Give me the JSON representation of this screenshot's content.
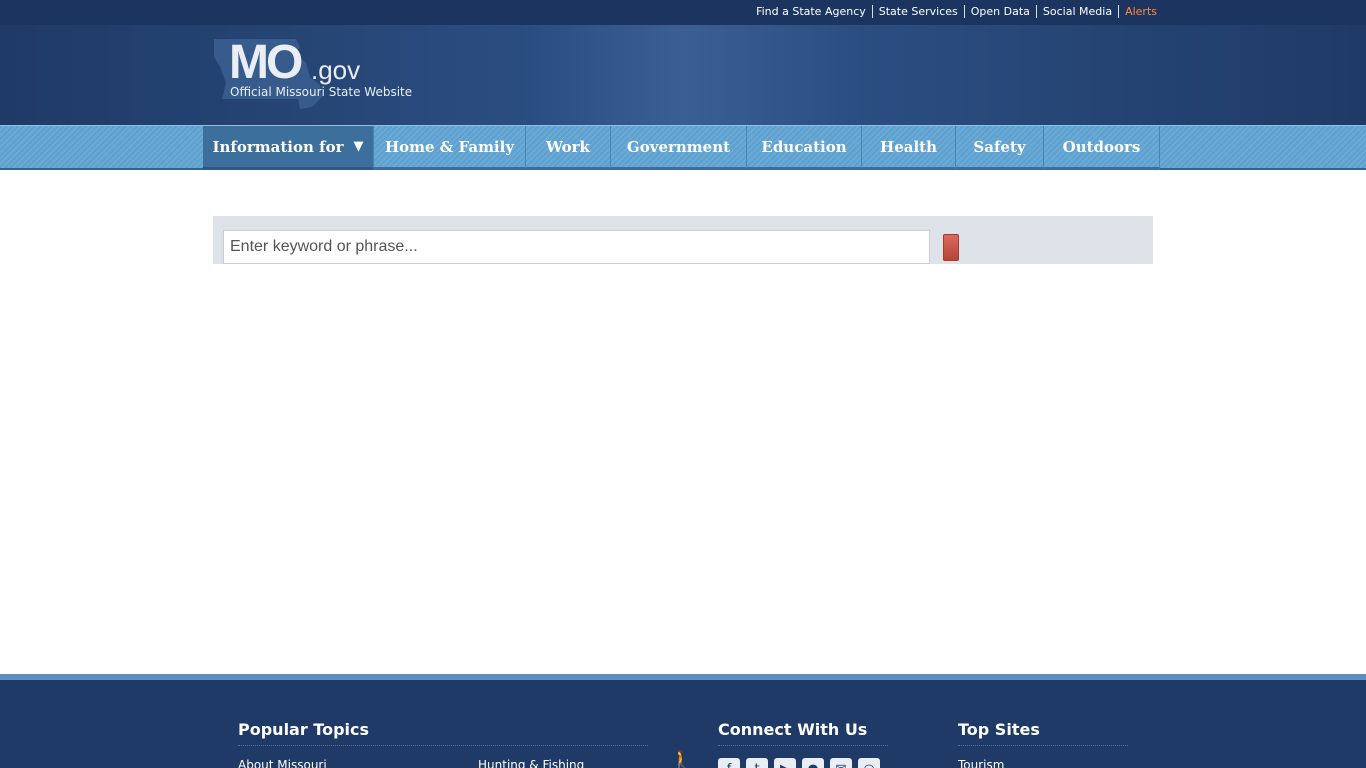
{
  "utility": {
    "links": [
      "Find a State Agency",
      "State Services",
      "Open Data",
      "Social Media"
    ],
    "alerts": "Alerts"
  },
  "logo": {
    "mo": "MO",
    "gov": ".gov",
    "tagline": "Official Missouri State Website"
  },
  "nav": {
    "items": [
      {
        "label": "Information for",
        "has_dropdown": true
      },
      {
        "label": "Home & Family"
      },
      {
        "label": "Work"
      },
      {
        "label": "Government"
      },
      {
        "label": "Education"
      },
      {
        "label": "Health"
      },
      {
        "label": "Safety"
      },
      {
        "label": "Outdoors"
      }
    ],
    "caret_glyph": "▼"
  },
  "search": {
    "placeholder": "Enter keyword or phrase...",
    "value": ""
  },
  "footer": {
    "popular": {
      "title": "Popular Topics",
      "links": [
        "About Missouri",
        "Hunting & Fishing"
      ]
    },
    "connect": {
      "title": "Connect With Us",
      "icons": [
        "facebook-icon",
        "twitter-icon",
        "youtube-icon",
        "flickr-icon",
        "email-icon",
        "rss-icon"
      ]
    },
    "top_sites": {
      "title": "Top Sites",
      "links": [
        "Tourism"
      ]
    }
  },
  "colors": {
    "header_bg": "#1f3a66",
    "nav_blue": "#6aaad7",
    "alert_orange": "#ff8a3d",
    "search_button": "#c0493d",
    "footer_bg": "#1f3a66"
  }
}
